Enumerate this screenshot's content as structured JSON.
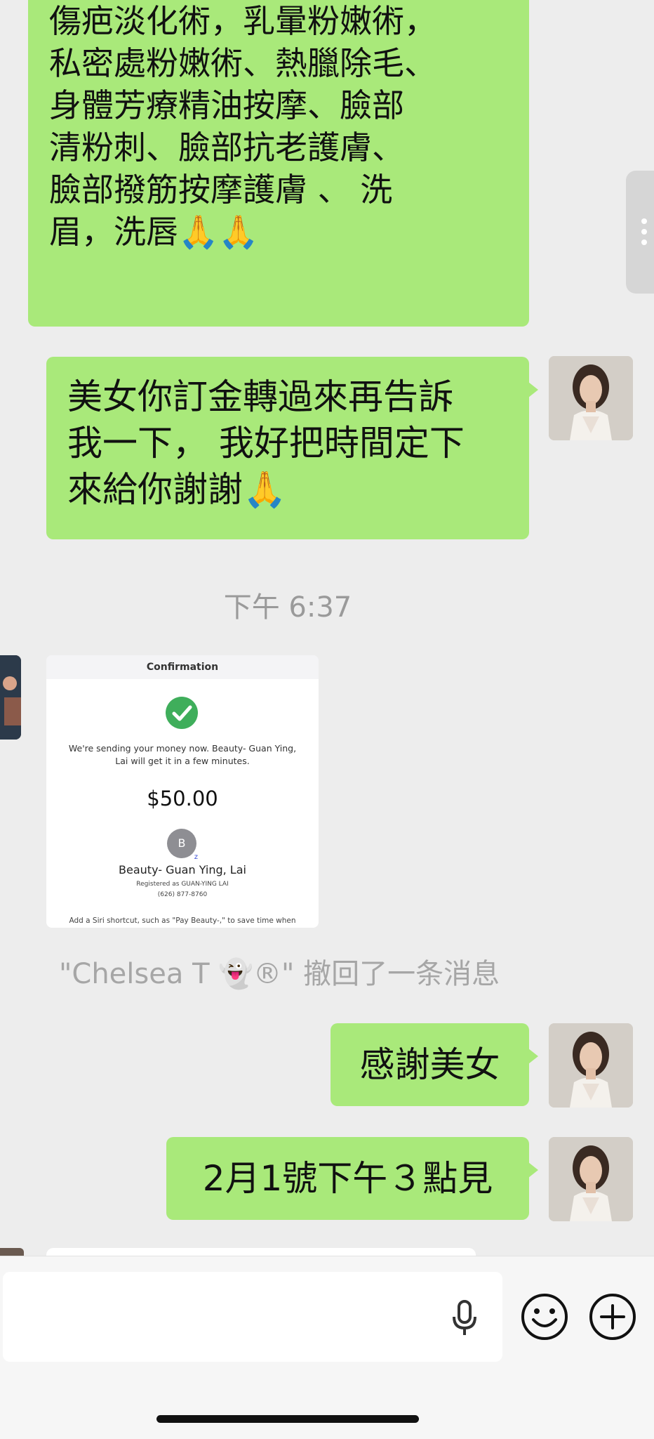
{
  "messages": {
    "m1": {
      "lines": "傷疤淡化術，乳暈粉嫩術，\n私密處粉嫩術、熱臘除毛、\n身體芳療精油按摩、臉部\n清粉刺、臉部抗老護膚、\n臉部撥筋按摩護膚 、 洗\n眉，洗唇",
      "emoji": "🙏🙏"
    },
    "m2": {
      "lines": "美女你訂金轉過來再告訴\n我一下， 我好把時間定下\n來給你謝謝",
      "emoji": "🙏"
    },
    "m3": {
      "text": "感謝美女"
    },
    "m4": {
      "text": "2月1號下午３點見"
    }
  },
  "timestamp": "下午 6:37",
  "receipt": {
    "header": "Confirmation",
    "message": "We're sending your money now. Beauty- Guan Ying, Lai will get it in a few minutes.",
    "amount": "$50.00",
    "avatar_letter": "B",
    "avatar_sub": "z",
    "recipient": "Beauty- Guan Ying, Lai",
    "registered": "Registered as GUAN-YING LAI",
    "phone": "(626) 877-8760",
    "siri_note": "Add a Siri shortcut, such as \"Pay Beauty-,\" to save time when"
  },
  "recall_notice": "\"Chelsea T 👻®\" 撤回了一条消息",
  "colors": {
    "bubble": "#a9e97a",
    "background": "#ededed",
    "check": "#3fae5b"
  },
  "icons": [
    "microphone-icon",
    "emoji-icon",
    "plus-icon",
    "check-icon"
  ]
}
